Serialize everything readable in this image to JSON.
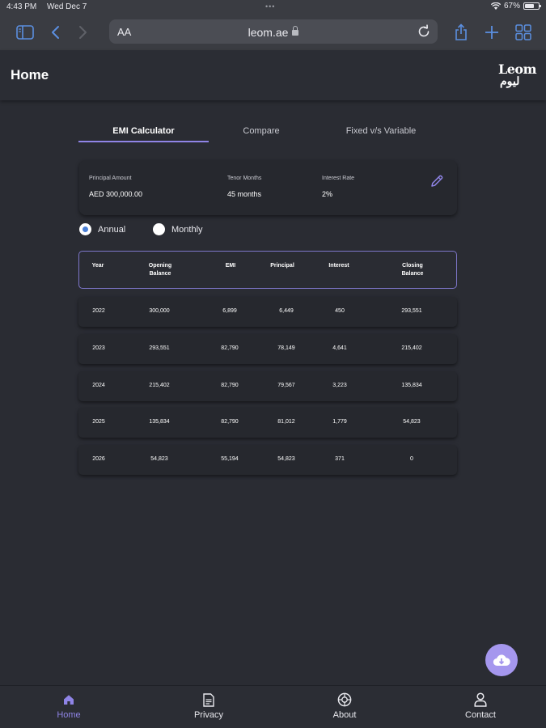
{
  "status_bar": {
    "time": "4:43 PM",
    "date": "Wed Dec 7",
    "battery": "67%"
  },
  "browser": {
    "text_size_label": "AA",
    "url": "leom.ae"
  },
  "header": {
    "title": "Home",
    "logo_text_latin": "Leom",
    "logo_text_arabic": "ليوم"
  },
  "tabs": [
    {
      "label": "EMI Calculator",
      "active": true
    },
    {
      "label": "Compare",
      "active": false
    },
    {
      "label": "Fixed v/s Variable",
      "active": false
    }
  ],
  "summary": {
    "principal_label": "Principal Amount",
    "principal_value": "AED 300,000.00",
    "tenor_label": "Tenor Months",
    "tenor_value": "45 months",
    "rate_label": "Interest Rate",
    "rate_value": "2%"
  },
  "frequency": {
    "annual_label": "Annual",
    "monthly_label": "Monthly",
    "selected": "Annual"
  },
  "table": {
    "headers": [
      "Year",
      "Opening\nBalance",
      "EMI",
      "Principal",
      "Interest",
      "Closing\nBalance"
    ],
    "rows": [
      [
        "2022",
        "300,000",
        "6,899",
        "6,449",
        "450",
        "293,551"
      ],
      [
        "2023",
        "293,551",
        "82,790",
        "78,149",
        "4,641",
        "215,402"
      ],
      [
        "2024",
        "215,402",
        "82,790",
        "79,567",
        "3,223",
        "135,834"
      ],
      [
        "2025",
        "135,834",
        "82,790",
        "81,012",
        "1,779",
        "54,823"
      ],
      [
        "2026",
        "54,823",
        "55,194",
        "54,823",
        "371",
        "0"
      ]
    ]
  },
  "bottom_nav": [
    {
      "label": "Home",
      "icon": "home-icon",
      "active": true
    },
    {
      "label": "Privacy",
      "icon": "document-icon",
      "active": false
    },
    {
      "label": "About",
      "icon": "about-icon",
      "active": false
    },
    {
      "label": "Contact",
      "icon": "person-icon",
      "active": false
    }
  ],
  "colors": {
    "accent": "#8f84e6",
    "fab": "#a597ee",
    "background": "#2a2c33",
    "radio_selected": "#4a7fd6"
  }
}
